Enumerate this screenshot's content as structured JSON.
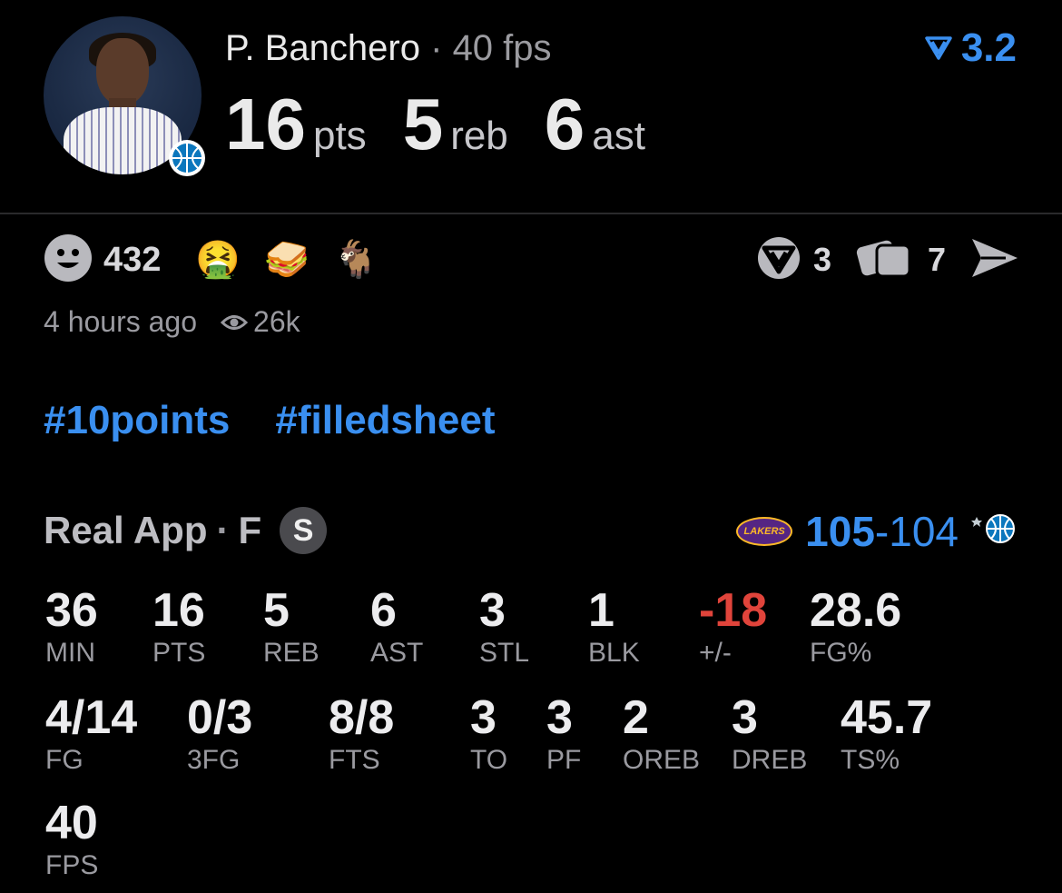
{
  "header": {
    "player_name": "P. Banchero",
    "separator": "·",
    "fps_label": "40 fps",
    "stats": [
      {
        "value": "16",
        "unit": "pts"
      },
      {
        "value": "5",
        "unit": "reb"
      },
      {
        "value": "6",
        "unit": "ast"
      }
    ],
    "rating": "3.2"
  },
  "reactions": {
    "smile_count": "432",
    "emojis": [
      "🤮",
      "🥪",
      "🐐"
    ],
    "real_count": "3",
    "cards_count": "7"
  },
  "meta": {
    "time": "4 hours ago",
    "views": "26k"
  },
  "tags": [
    "#10points",
    "#filledsheet"
  ],
  "game": {
    "source": "Real App",
    "sep": "·",
    "status": "F",
    "badge": "S",
    "home_score": "105",
    "dash": "-",
    "away_score": "104",
    "home_logo_text": "LAKERS"
  },
  "stats_rows": [
    [
      {
        "value": "36",
        "label": "MIN"
      },
      {
        "value": "16",
        "label": "PTS"
      },
      {
        "value": "5",
        "label": "REB"
      },
      {
        "value": "6",
        "label": "AST"
      },
      {
        "value": "3",
        "label": "STL"
      },
      {
        "value": "1",
        "label": "BLK"
      },
      {
        "value": "-18",
        "label": "+/-"
      },
      {
        "value": "28.6",
        "label": "FG%"
      }
    ],
    [
      {
        "value": "4/14",
        "label": "FG"
      },
      {
        "value": "0/3",
        "label": "3FG"
      },
      {
        "value": "8/8",
        "label": "FTS"
      },
      {
        "value": "3",
        "label": "TO"
      },
      {
        "value": "3",
        "label": "PF"
      },
      {
        "value": "2",
        "label": "OREB"
      },
      {
        "value": "3",
        "label": "DREB"
      },
      {
        "value": "45.7",
        "label": "TS%"
      }
    ],
    [
      {
        "value": "40",
        "label": "FPS"
      }
    ]
  ],
  "colors": {
    "accent": "#3a8ff0",
    "negative": "#e0443b",
    "background": "#000000"
  },
  "icons": [
    "smile-icon",
    "real-logo-icon",
    "cards-icon",
    "share-icon",
    "eye-icon",
    "magic-ball-icon",
    "lakers-logo-icon",
    "rating-arrow-icon"
  ]
}
